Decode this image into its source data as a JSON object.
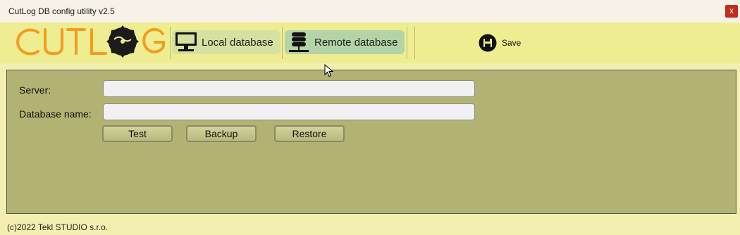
{
  "window": {
    "title": "CutLog DB config utility v2.5",
    "close_label": "x"
  },
  "toolbar": {
    "logo_text": "CUTLOG",
    "tabs": [
      {
        "label": "Local database",
        "icon": "monitor-icon"
      },
      {
        "label": "Remote database",
        "icon": "database-server-icon"
      }
    ],
    "save_label": "Save",
    "save_icon": "floppy-disk-icon"
  },
  "form": {
    "server_label": "Server:",
    "server_value": "",
    "database_label": "Database name:",
    "database_value": ""
  },
  "buttons": {
    "test": "Test",
    "backup": "Backup",
    "restore": "Restore"
  },
  "footer": {
    "copyright": "(c)2022 Tekl STUDIO s.r.o."
  },
  "colors": {
    "toolbar_bg": "#efed92",
    "panel_bg": "#b2b273",
    "accent_orange": "#f39c1e",
    "close_red": "#c42b1c"
  }
}
